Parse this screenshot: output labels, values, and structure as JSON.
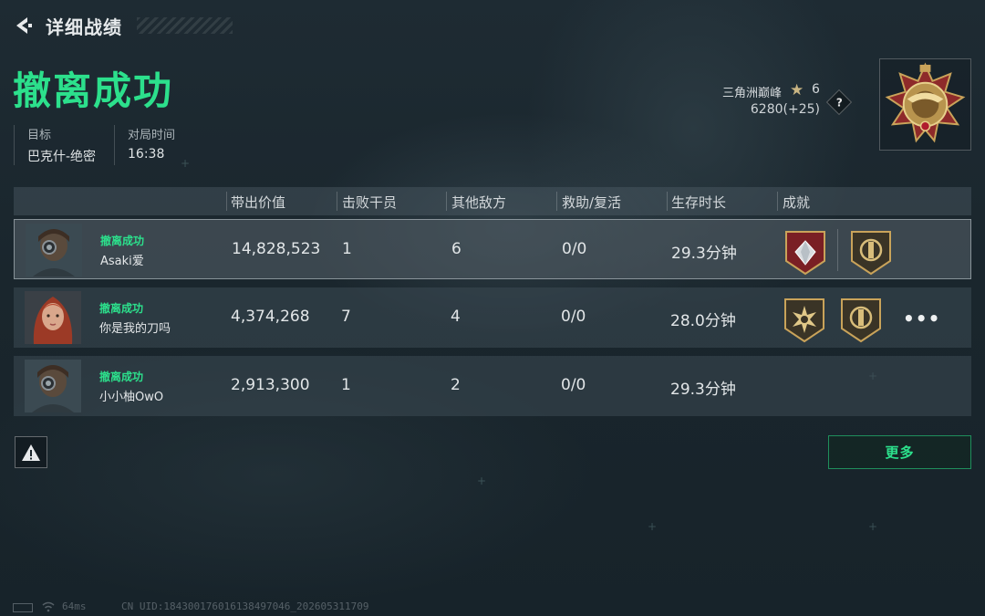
{
  "header": {
    "title": "详细战绩"
  },
  "result_title": "撤离成功",
  "info": [
    {
      "label": "目标",
      "value": "巴克什-绝密"
    },
    {
      "label": "对局时间",
      "value": "16:38"
    }
  ],
  "rank": {
    "name": "三角洲巅峰",
    "level": "6",
    "score": "6280(+25)",
    "help": "?"
  },
  "table": {
    "columns": [
      "带出价值",
      "击败干员",
      "其他敌方",
      "救助/复活",
      "生存时长",
      "成就"
    ],
    "rows": [
      {
        "status": "撤离成功",
        "name": "Asaki爱",
        "value": "14,828,523",
        "kills": "1",
        "others": "6",
        "assist": "0/0",
        "time": "29.3分钟",
        "achievements": [
          "diamond-badge-icon",
          "gold-badge-icon"
        ]
      },
      {
        "status": "撤离成功",
        "name": "你是我的刀吗",
        "value": "4,374,268",
        "kills": "7",
        "others": "4",
        "assist": "0/0",
        "time": "28.0分钟",
        "achievements": [
          "burst-badge-icon",
          "gold-badge-icon"
        ],
        "more": "•••"
      },
      {
        "status": "撤离成功",
        "name": "小小柚OwO",
        "value": "2,913,300",
        "kills": "1",
        "others": "2",
        "assist": "0/0",
        "time": "29.3分钟",
        "achievements": []
      }
    ]
  },
  "more_button": "更多",
  "footer": {
    "ping": "64ms",
    "uid": "CN UID:1843001760161384970​46_202605311709"
  },
  "colors": {
    "accent_green": "#2ce08c",
    "gold": "#c9b583",
    "background": "#1b272e"
  }
}
